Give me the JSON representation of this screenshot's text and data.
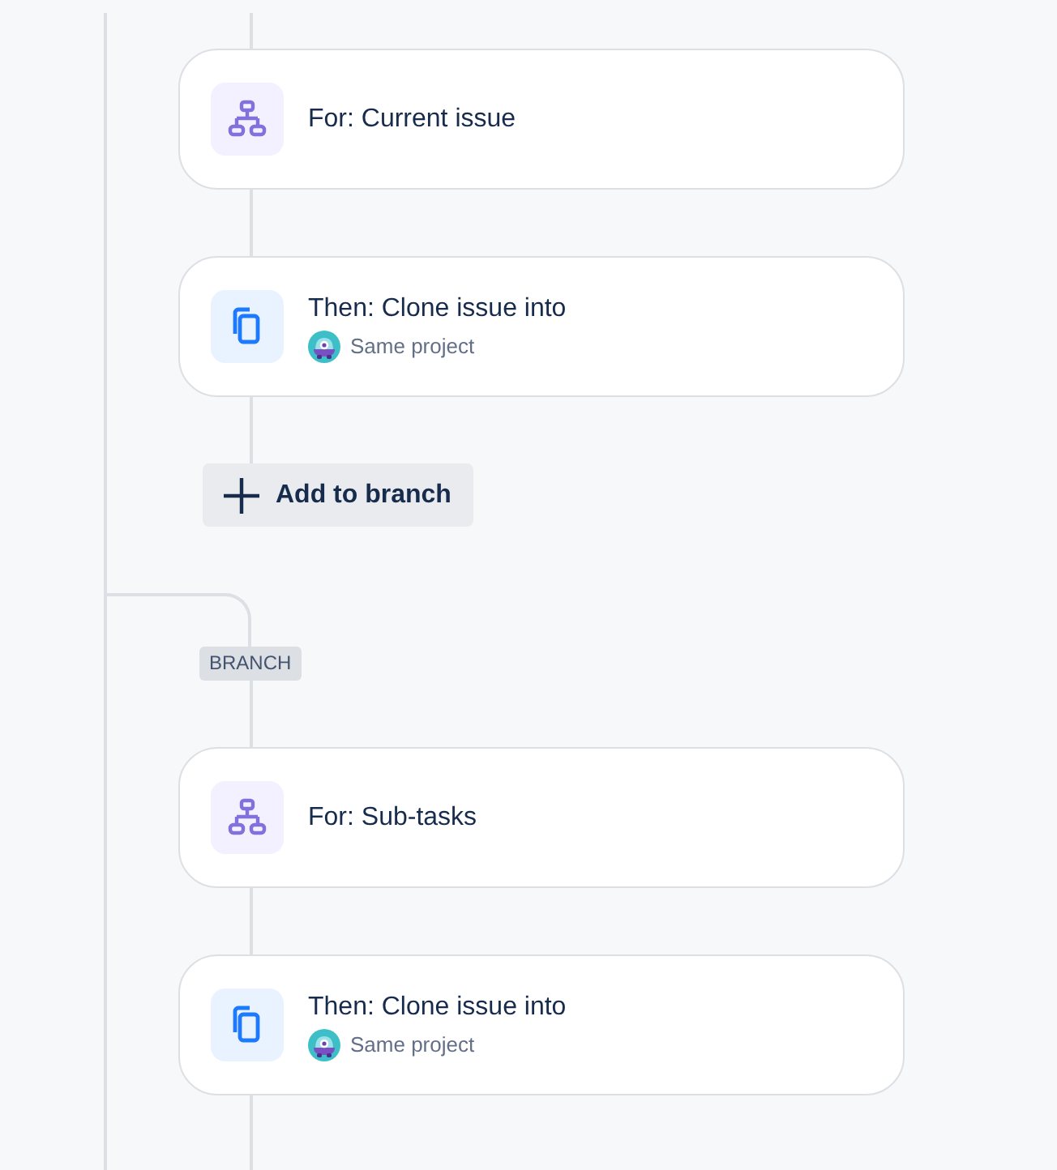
{
  "branches": [
    {
      "steps": [
        {
          "kind": "condition",
          "title": "For: Current issue"
        },
        {
          "kind": "action",
          "title": "Then: Clone issue into",
          "detail": "Same project"
        }
      ],
      "add_button": "Add to branch"
    },
    {
      "label": "BRANCH",
      "steps": [
        {
          "kind": "condition",
          "title": "For: Sub-tasks"
        },
        {
          "kind": "action",
          "title": "Then: Clone issue into",
          "detail": "Same project"
        }
      ]
    }
  ]
}
